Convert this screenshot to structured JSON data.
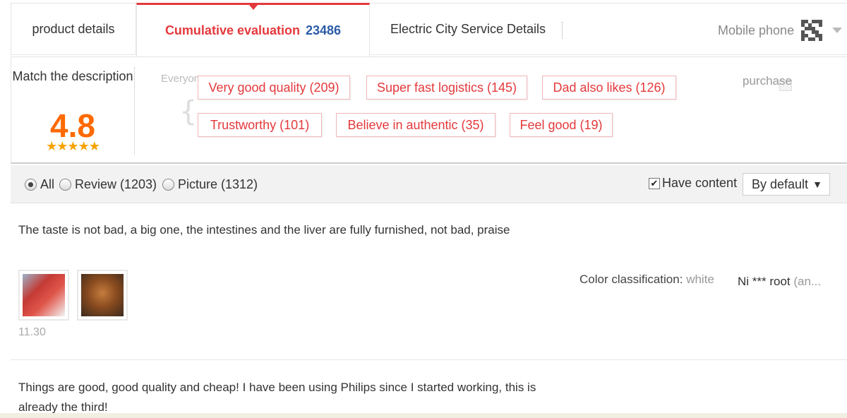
{
  "tabs": {
    "product": "product details",
    "cumulative_label": "Cumulative evaluation",
    "cumulative_count": "23486",
    "service": "Electric City Service Details",
    "mobile": "Mobile phone"
  },
  "rating": {
    "match_label": "Match the description",
    "score": "4.8",
    "stars": "★★★★★",
    "everyone_wrote": "Everyone wrote",
    "purchase": "purchase"
  },
  "tags": [
    "Very good quality (209)",
    "Super fast logistics (145)",
    "Dad also likes (126)",
    "Trustworthy (101)",
    "Believe in authentic (35)",
    "Feel good (19)"
  ],
  "filter": {
    "all": "All",
    "review": "Review (1203)",
    "picture": "Picture (1312)",
    "have_content": "Have content",
    "sort": "By default"
  },
  "reviews": [
    {
      "text": "The taste is not bad, a big one, the intestines and the liver are fully furnished, not bad, praise",
      "date": "11.30",
      "color_label": "Color classification:",
      "color_value": "white",
      "user": "Ni *** root",
      "user_suffix": "(an..."
    },
    {
      "text": "Things are good, good quality and cheap! I have been using Philips since I started working, this is already the third!"
    }
  ],
  "colors": {
    "accent": "#e4393c",
    "count": "#2b5ba8",
    "score": "#ff6a00",
    "star": "#f4a300"
  }
}
